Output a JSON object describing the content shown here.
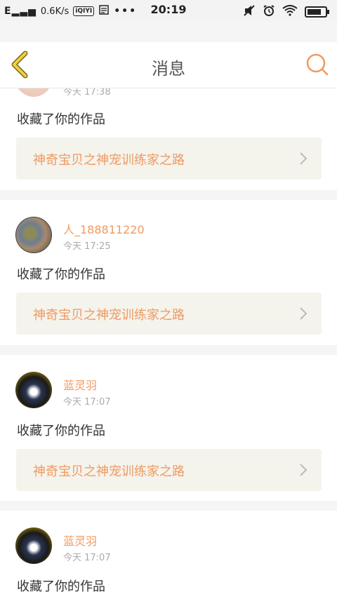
{
  "status_bar": {
    "signal_text": "E",
    "net_speed": "0.6K/s",
    "app_badge": "iQIYI",
    "more": "•••",
    "time": "20:19",
    "battery_level": 0.8
  },
  "header": {
    "title": "消息"
  },
  "notifications": [
    {
      "username": "",
      "time": "今天 17:38",
      "action": "收藏了你的作品",
      "work_title": "神奇宝贝之神宠训练家之路"
    },
    {
      "username": "人_188811220",
      "time": "今天 17:25",
      "action": "收藏了你的作品",
      "work_title": "神奇宝贝之神宠训练家之路"
    },
    {
      "username": "蓝灵羽",
      "time": "今天 17:07",
      "action": "收藏了你的作品",
      "work_title": "神奇宝贝之神宠训练家之路"
    },
    {
      "username": "蓝灵羽",
      "time": "今天 17:07",
      "action": "收藏了你的作品",
      "work_title": ""
    }
  ],
  "colors": {
    "accent": "#f09a62",
    "back_arrow": "#e8c020",
    "work_box_bg": "#f4f3ec",
    "separator": "#f5f5f5"
  }
}
